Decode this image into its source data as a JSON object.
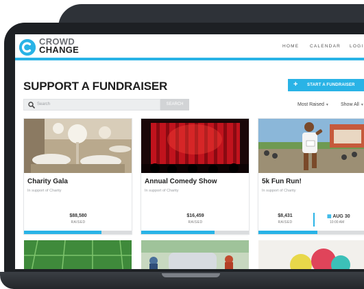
{
  "brand": {
    "line1": "CROWD",
    "line2": "CHANGE",
    "accent": "#29b3e6"
  },
  "nav": {
    "items": [
      "HOME",
      "CALENDAR",
      "LOGI"
    ]
  },
  "page": {
    "title": "SUPPORT A FUNDRAISER",
    "start_button": "START A FUNDRAISER",
    "start_icon": "+"
  },
  "search": {
    "placeholder": "Search",
    "button": "SEARCH"
  },
  "sort": {
    "most_raised": "Most Raised",
    "show_all": "Show All"
  },
  "cards": [
    {
      "title": "Charity Gala",
      "support": "In support of Charity",
      "amount": "$88,580",
      "raised_label": "RAISED",
      "progress": 0.72
    },
    {
      "title": "Annual Comedy Show",
      "support": "In support of Charity",
      "amount": "$16,459",
      "raised_label": "RAISED",
      "progress": 0.68
    },
    {
      "title": "5k Fun Run!",
      "support": "In support of Charity",
      "amount": "$8,431",
      "raised_label": "RAISED",
      "date": "AUG 30",
      "time": "10:00 AM",
      "progress": 0.55
    }
  ],
  "icons": {
    "search": "search-icon",
    "logo": "logo-icon",
    "calendar": "calendar-icon",
    "caret": "chevron-down-icon"
  }
}
